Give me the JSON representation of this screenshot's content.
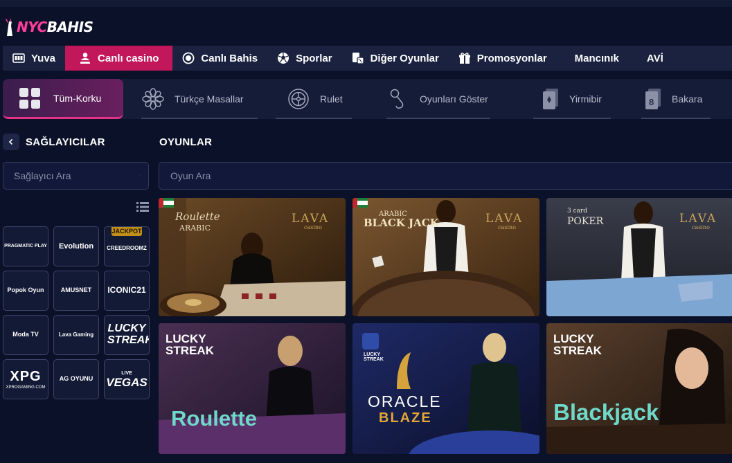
{
  "brand": {
    "logo_part1": "NYC",
    "logo_part2": "BAHIS"
  },
  "main_nav": [
    {
      "label": "Yuva",
      "icon": "slot-machine-icon"
    },
    {
      "label": "Canlı casino",
      "icon": "dealer-icon",
      "active": true
    },
    {
      "label": "Canlı Bahis",
      "icon": "live-dot-icon"
    },
    {
      "label": "Sporlar",
      "icon": "football-icon"
    },
    {
      "label": "Diğer Oyunlar",
      "icon": "dice-cards-icon"
    },
    {
      "label": "Promosyonlar",
      "icon": "gift-icon"
    },
    {
      "label": "Mancınık",
      "icon": ""
    },
    {
      "label": "AVİ",
      "icon": ""
    }
  ],
  "categories": [
    {
      "label": "Tüm-Korku",
      "icon": "grid-icon",
      "active": true
    },
    {
      "label": "Türkçe Masallar",
      "icon": "ornament-icon"
    },
    {
      "label": "Rulet",
      "icon": "roulette-icon"
    },
    {
      "label": "Oyunları Göster",
      "icon": "microphone-icon"
    },
    {
      "label": "Yirmibir",
      "icon": "cards-icon"
    },
    {
      "label": "Bakara",
      "icon": "eight-card-icon"
    }
  ],
  "providers": {
    "title": "SAĞLAYICILAR",
    "search_placeholder": "Sağlayıcı Ara",
    "items": [
      {
        "label": "PRAGMATIC PLAY"
      },
      {
        "label": "Evolution"
      },
      {
        "label": "CREEDROOMZ",
        "badge": "JACKPOT"
      },
      {
        "label": "Popok Oyun"
      },
      {
        "label": "AMUSNET"
      },
      {
        "label": "ICONIC21"
      },
      {
        "label": "Moda TV"
      },
      {
        "label": "Lava Gaming"
      },
      {
        "label": "LUCKY STREAK"
      },
      {
        "label": "XPG",
        "sub": "XPROGAMING.COM"
      },
      {
        "label": "AG OYUNU"
      },
      {
        "label": "VEGAS",
        "sub": "LIVE"
      }
    ]
  },
  "games": {
    "title": "OYUNLAR",
    "search_placeholder": "Oyun Ara",
    "cards": [
      {
        "title_line1": "Roulette",
        "title_line2": "ARABIC",
        "brand": "LAVA",
        "brand_sub": "casino"
      },
      {
        "title_line1": "BLACK JACK",
        "title_line2": "ARABIC",
        "brand": "LAVA",
        "brand_sub": "casino"
      },
      {
        "title_line1": "POKER",
        "title_line2": "3 card",
        "brand": "LAVA",
        "brand_sub": "casino"
      },
      {
        "title_line1": "Roulette",
        "title_line2": "",
        "brand": "LUCKY STREAK",
        "brand_sub": ""
      },
      {
        "title_line1": "ORACLE",
        "title_line2": "BLAZE",
        "brand": "LUCKY STREAK",
        "brand_sub": ""
      },
      {
        "title_line1": "Blackjack",
        "title_line2": "",
        "brand": "LUCKY STREAK",
        "brand_sub": ""
      }
    ]
  },
  "colors": {
    "bg": "#0b1129",
    "accent": "#c2185b",
    "nav": "#1a2240",
    "gold": "#c9a45c",
    "teal": "#6fd8c8"
  }
}
